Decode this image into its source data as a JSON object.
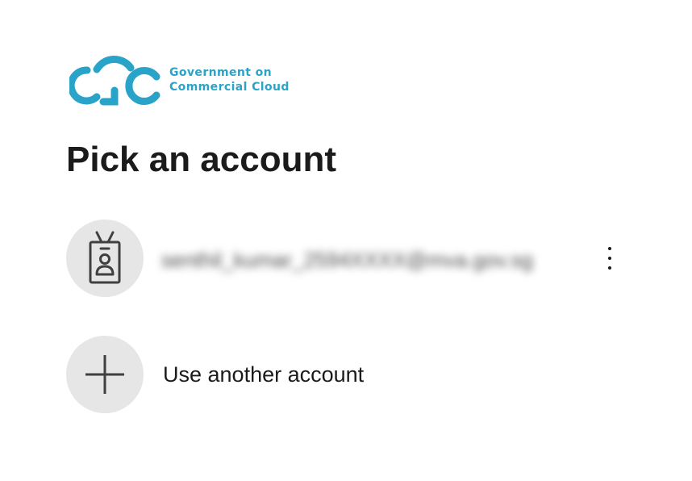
{
  "brand": {
    "line1": "Government on",
    "line2": "Commercial Cloud",
    "color": "#2aa3c9"
  },
  "page": {
    "title": "Pick an account"
  },
  "accounts": [
    {
      "email": "senthil_kumar_2594XXXX@mva.gov.sg",
      "email_obscured": true,
      "avatar_icon": "id-badge-icon",
      "menu_icon": "more-options-icon"
    }
  ],
  "other_account": {
    "label": "Use another account",
    "icon": "plus-icon"
  },
  "colors": {
    "text": "#1b1b1b",
    "avatar_bg": "#e6e6e6",
    "icon": "#404040"
  }
}
